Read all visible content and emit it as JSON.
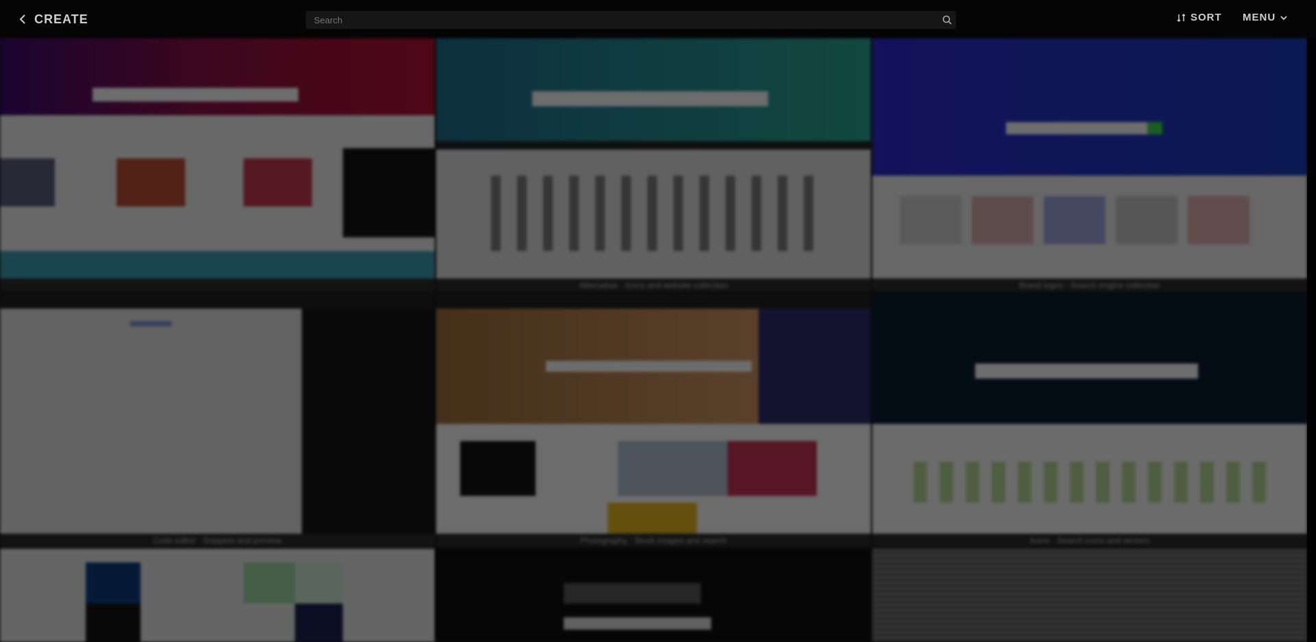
{
  "header": {
    "brand_label": "CREATE",
    "search_placeholder": "Search",
    "sort_label": "SORT",
    "menu_label": "MENU"
  },
  "tiles": [
    {
      "caption": ""
    },
    {
      "caption": "Alternative · Icons and website collection"
    },
    {
      "caption": "Brand logos · Search engine collection"
    },
    {
      "caption": "Code editor · Snippets and preview"
    },
    {
      "caption": "Photography · Stock images and search"
    },
    {
      "caption": "Icons · Search icons and vectors"
    },
    {
      "caption": ""
    },
    {
      "caption": ""
    },
    {
      "caption": ""
    }
  ]
}
